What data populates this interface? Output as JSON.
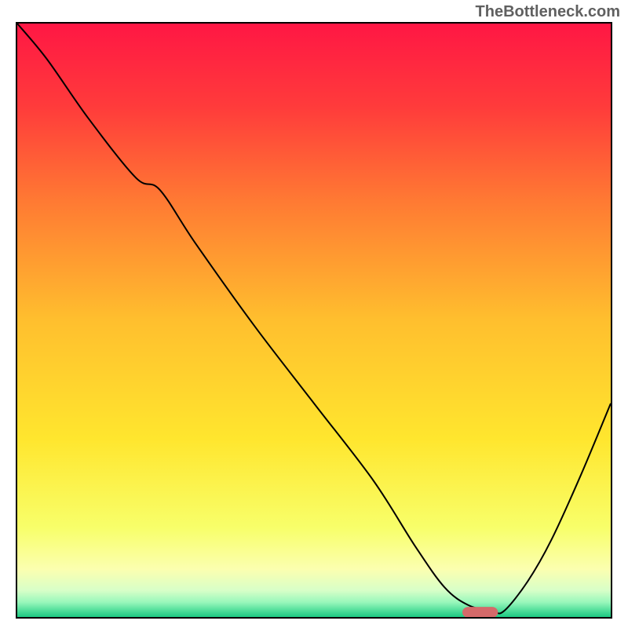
{
  "watermark": "TheBottleneck.com",
  "chart_data": {
    "type": "line",
    "title": "",
    "xlabel": "",
    "ylabel": "",
    "xlim": [
      0,
      100
    ],
    "ylim": [
      0,
      100
    ],
    "grid": false,
    "legend": false,
    "curve": {
      "x": [
        0,
        5,
        12,
        20,
        24,
        30,
        40,
        50,
        60,
        67,
        72,
        76,
        80,
        82,
        86,
        90,
        95,
        100
      ],
      "y": [
        100,
        94,
        84,
        74,
        72,
        63,
        49,
        36,
        23,
        12,
        5,
        2,
        1,
        1,
        6,
        13,
        24,
        36
      ]
    },
    "marker": {
      "shape": "rounded-rect",
      "fill": "#d46a6a",
      "cx": 78,
      "cy": 0.8,
      "w": 6,
      "h": 1.8
    },
    "background_gradient": {
      "stops": [
        {
          "offset": 0,
          "color": "#ff1744"
        },
        {
          "offset": 0.14,
          "color": "#ff3b3b"
        },
        {
          "offset": 0.3,
          "color": "#ff7a33"
        },
        {
          "offset": 0.5,
          "color": "#ffbf2e"
        },
        {
          "offset": 0.7,
          "color": "#ffe62e"
        },
        {
          "offset": 0.85,
          "color": "#f8ff6a"
        },
        {
          "offset": 0.92,
          "color": "#fbffb0"
        },
        {
          "offset": 0.955,
          "color": "#d8ffc8"
        },
        {
          "offset": 0.975,
          "color": "#99f7bb"
        },
        {
          "offset": 0.99,
          "color": "#4bdc98"
        },
        {
          "offset": 1.0,
          "color": "#1cc882"
        }
      ]
    }
  }
}
